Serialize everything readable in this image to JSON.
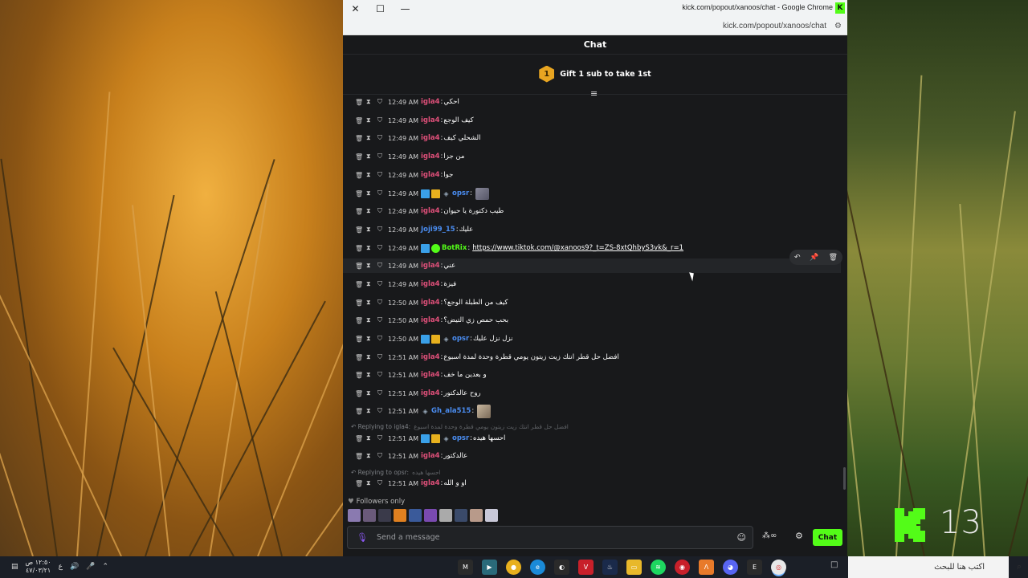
{
  "browser": {
    "window_title": "kick.com/popout/xanoos/chat - Google Chrome",
    "url": "kick.com/popout/xanoos/chat",
    "favicon_letter": "K"
  },
  "chat": {
    "header": "Chat",
    "gift_rank": "1",
    "gift_text": "Gift 1 sub to take 1st",
    "messages": [
      {
        "time": "12:49 AM",
        "user": "igla4",
        "user_color": "#e0507a",
        "text": "احكي",
        "badges": []
      },
      {
        "time": "12:49 AM",
        "user": "igla4",
        "user_color": "#e0507a",
        "text": "كيف الوجع",
        "badges": []
      },
      {
        "time": "12:49 AM",
        "user": "igla4",
        "user_color": "#e0507a",
        "text": "الشحلي كيف",
        "badges": []
      },
      {
        "time": "12:49 AM",
        "user": "igla4",
        "user_color": "#e0507a",
        "text": "من جزا",
        "badges": []
      },
      {
        "time": "12:49 AM",
        "user": "igla4",
        "user_color": "#e0507a",
        "text": "جوا",
        "badges": []
      },
      {
        "time": "12:49 AM",
        "user": "opsr",
        "user_color": "#4a8cf0",
        "text": "",
        "badges": [
          "blue",
          "gold",
          "spy"
        ],
        "emote": true
      },
      {
        "time": "12:49 AM",
        "user": "igla4",
        "user_color": "#e0507a",
        "text": "طيب دكتورة يا حيوان",
        "badges": []
      },
      {
        "time": "12:49 AM",
        "user": "Joji99_15",
        "user_color": "#4a8cf0",
        "text": "عليك",
        "badges": []
      },
      {
        "time": "12:49 AM",
        "user": "BotRix",
        "user_color": "#53fc18",
        "text": "https://www.tiktok.com/@xanoos9?_t=ZS-8xtQhbyS3vk&_r=1",
        "badges": [
          "blue",
          "green"
        ],
        "link": true
      },
      {
        "time": "12:49 AM",
        "user": "igla4",
        "user_color": "#e0507a",
        "text": "عني",
        "badges": [],
        "highlight": true
      },
      {
        "time": "12:49 AM",
        "user": "igla4",
        "user_color": "#e0507a",
        "text": "فيزة",
        "badges": []
      },
      {
        "time": "12:50 AM",
        "user": "igla4",
        "user_color": "#e0507a",
        "text": "كيف من الطبلة الوجع؟",
        "badges": []
      },
      {
        "time": "12:50 AM",
        "user": "igla4",
        "user_color": "#e0507a",
        "text": "بحب حمص زي التيض؟",
        "badges": []
      },
      {
        "time": "12:50 AM",
        "user": "opsr",
        "user_color": "#4a8cf0",
        "text": "نزل نزل عليك",
        "badges": [
          "blue",
          "gold",
          "spy"
        ]
      },
      {
        "time": "12:51 AM",
        "user": "igla4",
        "user_color": "#e0507a",
        "text": "افضل حل قطر انتك زيت زيتون يومي قطرة وحدة لمدة اسبوع",
        "badges": []
      },
      {
        "time": "12:51 AM",
        "user": "igla4",
        "user_color": "#e0507a",
        "text": "و بعدين ما خف",
        "badges": []
      },
      {
        "time": "12:51 AM",
        "user": "igla4",
        "user_color": "#e0507a",
        "text": "روح عالدكتور",
        "badges": []
      },
      {
        "time": "12:51 AM",
        "user": "Gh_ala515",
        "user_color": "#4a8cf0",
        "text": "",
        "badges": [
          "spy"
        ],
        "emote": true
      },
      {
        "time": "12:51 AM",
        "user": "opsr",
        "user_color": "#4a8cf0",
        "text": "احسها هيده",
        "badges": [
          "blue",
          "gold",
          "spy"
        ]
      },
      {
        "time": "12:51 AM",
        "user": "igla4",
        "user_color": "#e0507a",
        "text": "عالدكتور",
        "badges": []
      },
      {
        "time": "12:51 AM",
        "user": "igla4",
        "user_color": "#e0507a",
        "text": "او و الله",
        "badges": []
      }
    ],
    "replies": [
      {
        "label": "Replying to igla4:",
        "quote": "افضل حل قطر انتك زيت زيتون يومي قطرة وحدة لمدة اسبوع"
      },
      {
        "label": "Replying to opsr:",
        "quote": "احسها هيده"
      }
    ],
    "followers_only": "Followers only",
    "input_placeholder": "Send a message",
    "send_label": "Chat"
  },
  "overlay": {
    "kick_number": "13"
  },
  "taskbar": {
    "search_placeholder": "اكتب هنا للبحث",
    "clock_time": "١٢:٥٠ ص",
    "clock_date": "٤٧/٠٣/٢١",
    "lang": "ع",
    "show_desktop": "□"
  }
}
